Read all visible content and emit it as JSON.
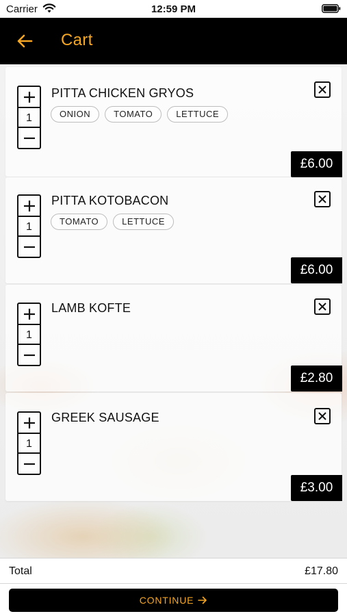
{
  "status_bar": {
    "carrier": "Carrier",
    "time": "12:59 PM",
    "wifi_icon": "wifi-icon",
    "battery_icon": "battery-icon"
  },
  "header": {
    "title": "Cart",
    "back_icon": "arrow-left-icon",
    "accent_color": "#f5a623",
    "background": "#000000"
  },
  "cart": {
    "items": [
      {
        "name": "PITTA CHICKEN GRYOS",
        "quantity": "1",
        "tags": [
          "ONION",
          "TOMATO",
          "LETTUCE"
        ],
        "price": "£6.00"
      },
      {
        "name": "PITTA KOTOBACON",
        "quantity": "1",
        "tags": [
          "TOMATO",
          "LETTUCE"
        ],
        "price": "£6.00"
      },
      {
        "name": "LAMB KOFTE",
        "quantity": "1",
        "tags": [],
        "price": "£2.80"
      },
      {
        "name": "GREEK SAUSAGE",
        "quantity": "1",
        "tags": [],
        "price": "£3.00"
      }
    ],
    "plus_icon": "plus-icon",
    "minus_icon": "minus-icon",
    "remove_icon": "close-icon"
  },
  "footer": {
    "total_label": "Total",
    "total_value": "£17.80",
    "continue_label": "CONTINUE",
    "continue_icon": "arrow-right-icon"
  }
}
